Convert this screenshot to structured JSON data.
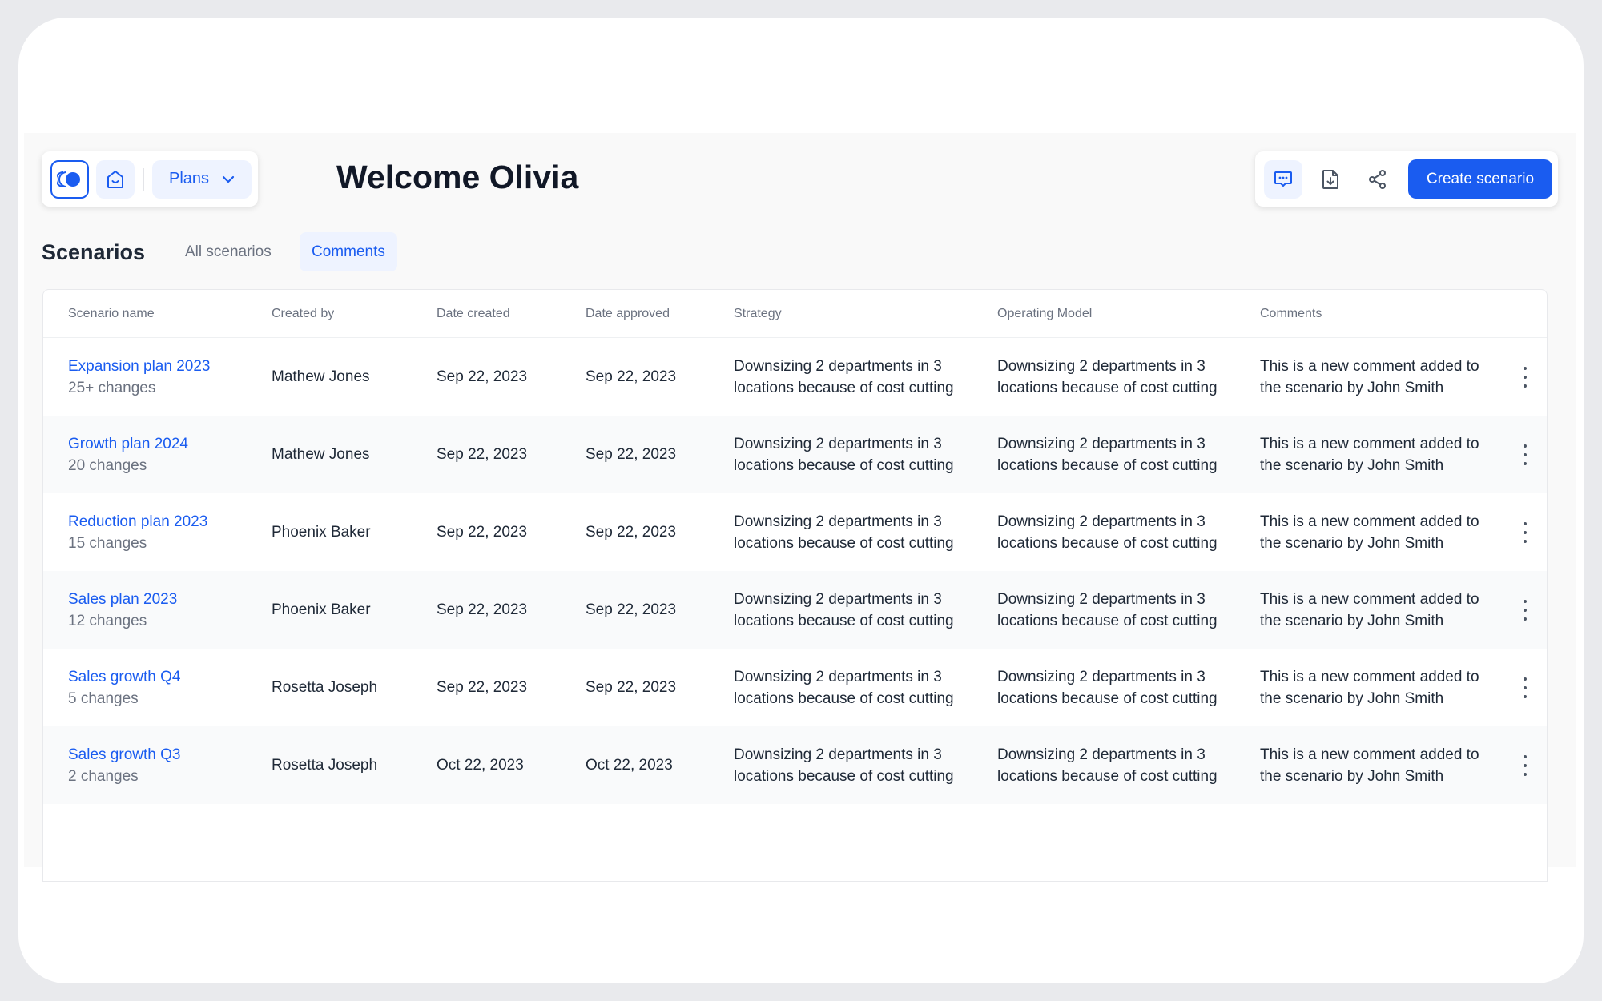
{
  "header": {
    "title": "Welcome Olivia",
    "plans_label": "Plans",
    "create_label": "Create scenario"
  },
  "colors": {
    "accent": "#1a5cf0"
  },
  "section": {
    "title": "Scenarios",
    "tabs": [
      {
        "label": "All scenarios",
        "active": false
      },
      {
        "label": "Comments",
        "active": true
      }
    ]
  },
  "table": {
    "columns": [
      "Scenario name",
      "Created by",
      "Date created",
      "Date approved",
      "Strategy",
      "Operating Model",
      "Comments"
    ],
    "rows": [
      {
        "name": "Expansion plan 2023",
        "changes": "25+ changes",
        "created_by": "Mathew Jones",
        "date_created": "Sep 22, 2023",
        "date_approved": "Sep 22, 2023",
        "strategy": [
          "Downsizing 2 departments in 3",
          "locations because of cost cutting"
        ],
        "model": [
          "Downsizing 2 departments in 3",
          "locations because of cost cutting"
        ],
        "comment": [
          "This is a new comment added to",
          "the scenario by John Smith"
        ]
      },
      {
        "name": "Growth plan 2024",
        "changes": "20 changes",
        "created_by": "Mathew Jones",
        "date_created": "Sep 22, 2023",
        "date_approved": "Sep 22, 2023",
        "strategy": [
          "Downsizing 2 departments in 3",
          "locations because of cost cutting"
        ],
        "model": [
          "Downsizing 2 departments in 3",
          "locations because of cost cutting"
        ],
        "comment": [
          "This is a new comment added to",
          "the scenario by John Smith"
        ]
      },
      {
        "name": "Reduction plan 2023",
        "changes": "15 changes",
        "created_by": "Phoenix Baker",
        "date_created": "Sep 22, 2023",
        "date_approved": "Sep 22, 2023",
        "strategy": [
          "Downsizing 2 departments in 3",
          "locations because of cost cutting"
        ],
        "model": [
          "Downsizing 2 departments in 3",
          "locations because of cost cutting"
        ],
        "comment": [
          "This is a new comment added to",
          "the scenario by John Smith"
        ]
      },
      {
        "name": "Sales plan 2023",
        "changes": "12 changes",
        "created_by": "Phoenix Baker",
        "date_created": "Sep 22, 2023",
        "date_approved": "Sep 22, 2023",
        "strategy": [
          "Downsizing 2 departments in 3",
          "locations because of cost cutting"
        ],
        "model": [
          "Downsizing 2 departments in 3",
          "locations because of cost cutting"
        ],
        "comment": [
          "This is a new comment added to",
          "the scenario by John Smith"
        ]
      },
      {
        "name": "Sales growth Q4",
        "changes": "5 changes",
        "created_by": "Rosetta Joseph",
        "date_created": "Sep 22, 2023",
        "date_approved": "Sep 22, 2023",
        "strategy": [
          "Downsizing 2 departments in 3",
          "locations because of cost cutting"
        ],
        "model": [
          "Downsizing 2 departments in 3",
          "locations because of cost cutting"
        ],
        "comment": [
          "This is a new comment added to",
          "the scenario by John Smith"
        ]
      },
      {
        "name": "Sales growth Q3",
        "changes": "2 changes",
        "created_by": "Rosetta Joseph",
        "date_created": "Oct 22, 2023",
        "date_approved": "Oct 22, 2023",
        "strategy": [
          "Downsizing 2 departments in 3",
          "locations because of cost cutting"
        ],
        "model": [
          "Downsizing 2 departments in 3",
          "locations because of cost cutting"
        ],
        "comment": [
          "This is a new comment added to",
          "the scenario by John Smith"
        ]
      }
    ]
  }
}
